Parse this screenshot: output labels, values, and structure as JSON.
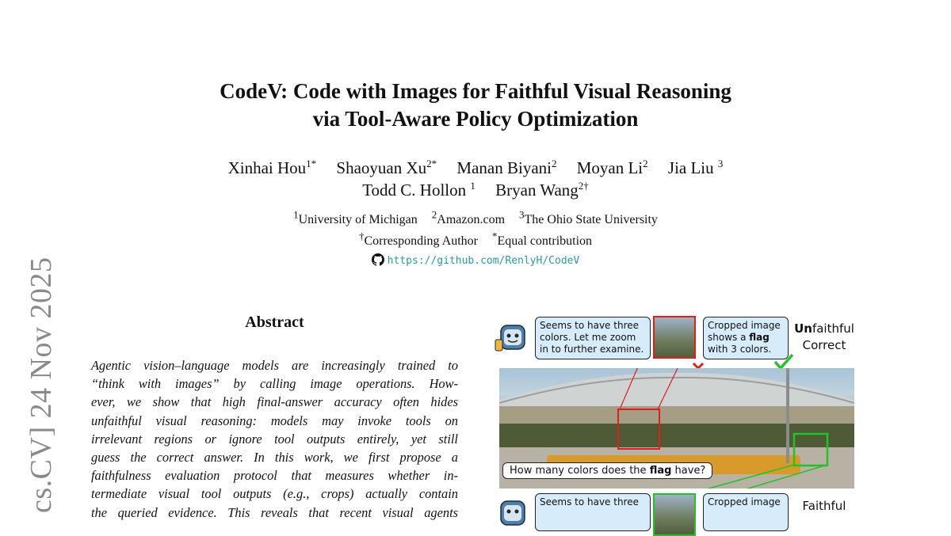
{
  "side_stamp": "cs.CV]  24 Nov 2025",
  "title": {
    "line1": "CodeV: Code with Images for Faithful Visual Reasoning",
    "line2": "via Tool-Aware Policy Optimization"
  },
  "authors_line1": [
    {
      "name": "Xinhai Hou",
      "sup": "1*"
    },
    {
      "name": "Shaoyuan Xu",
      "sup": "2*"
    },
    {
      "name": "Manan Biyani",
      "sup": "2"
    },
    {
      "name": "Moyan Li",
      "sup": "2"
    },
    {
      "name": "Jia Liu",
      "sup": "3"
    }
  ],
  "authors_line2": [
    {
      "name": "Todd C. Hollon",
      "sup": "1"
    },
    {
      "name": "Bryan Wang",
      "sup": "2†"
    }
  ],
  "affiliations": [
    {
      "sup": "1",
      "name": "University of Michigan"
    },
    {
      "sup": "2",
      "name": "Amazon.com"
    },
    {
      "sup": "3",
      "name": "The Ohio State University"
    }
  ],
  "notes": [
    {
      "sup": "†",
      "text": "Corresponding Author"
    },
    {
      "sup": "*",
      "text": "Equal contribution"
    }
  ],
  "repo_url": "https://github.com/RenlyH/CodeV",
  "abstract": {
    "heading": "Abstract",
    "lines": [
      "Agentic vision–language models are increasingly trained to",
      "“think with images” by calling image operations.  How-",
      "ever, we show that high final-answer accuracy often hides",
      "unfaithful visual reasoning:  models may invoke tools on",
      "irrelevant regions or ignore tool outputs entirely, yet still",
      "guess the correct answer.  In this work, we first propose a",
      "faithfulness evaluation protocol that measures whether in-",
      "termediate visual tool outputs (e.g., crops) actually contain",
      "the queried evidence. This reveals that recent visual agents"
    ]
  },
  "figure": {
    "top_thought": "Seems to have three colors. Let me zoom in to further examine.",
    "top_result_pre": "Cropped image shows a ",
    "top_result_bold": "flag",
    "top_result_post": " with 3 colors.",
    "top_label_bold": "Un",
    "top_label_rest": "faithful",
    "top_label_line2": "Correct",
    "question_pre": "How many colors does the ",
    "question_bold": "flag",
    "question_post": " have?",
    "bottom_thought": "Seems to have three",
    "bottom_result": "Cropped image",
    "bottom_label": "Faithful",
    "colors": {
      "wrong": "#e11d1d",
      "right": "#22c22a",
      "bubble": "#d7ecfb"
    }
  }
}
